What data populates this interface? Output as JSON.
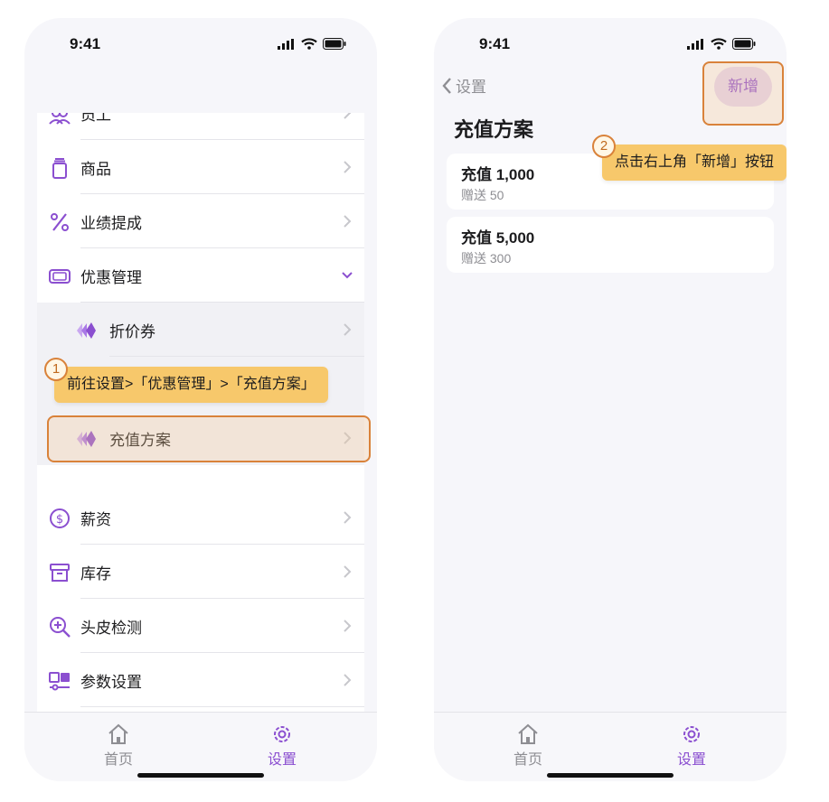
{
  "left_screen": {
    "status": {
      "time": "9:41"
    },
    "menu": {
      "items": [
        {
          "label": "员工",
          "icon": "staff-icon"
        },
        {
          "label": "商品",
          "icon": "product-icon"
        },
        {
          "label": "业绩提成",
          "icon": "percent-icon"
        },
        {
          "label": "优惠管理",
          "icon": "discount-icon",
          "expanded": true
        },
        {
          "label": "折价券",
          "icon": "coupon-icon",
          "sub": true
        },
        {
          "label": "充值方案",
          "icon": "recharge-icon",
          "sub": true
        },
        {
          "label": "薪资",
          "icon": "salary-icon"
        },
        {
          "label": "库存",
          "icon": "inventory-icon"
        },
        {
          "label": "头皮检测",
          "icon": "scalp-check-icon"
        },
        {
          "label": "参数设置",
          "icon": "parameter-icon"
        }
      ]
    },
    "tooltip": {
      "step": "1",
      "text": "前往设置>「优惠管理」>「充值方案」"
    },
    "tabbar": {
      "home_label": "首页",
      "settings_label": "设置"
    }
  },
  "right_screen": {
    "status": {
      "time": "9:41"
    },
    "nav": {
      "back_label": "设置",
      "add_label": "新增"
    },
    "title": "充值方案",
    "plans": [
      {
        "title": "充值 1,000",
        "subtitle": "赠送 50"
      },
      {
        "title": "充值 5,000",
        "subtitle": "赠送 300"
      }
    ],
    "tooltip": {
      "step": "2",
      "text": "点击右上角「新增」按钮"
    },
    "tabbar": {
      "home_label": "首页",
      "settings_label": "设置"
    }
  },
  "colors": {
    "accent": "#8b4fd0",
    "highlight": "#d9823a",
    "tooltip_bg": "#f7c86b"
  }
}
